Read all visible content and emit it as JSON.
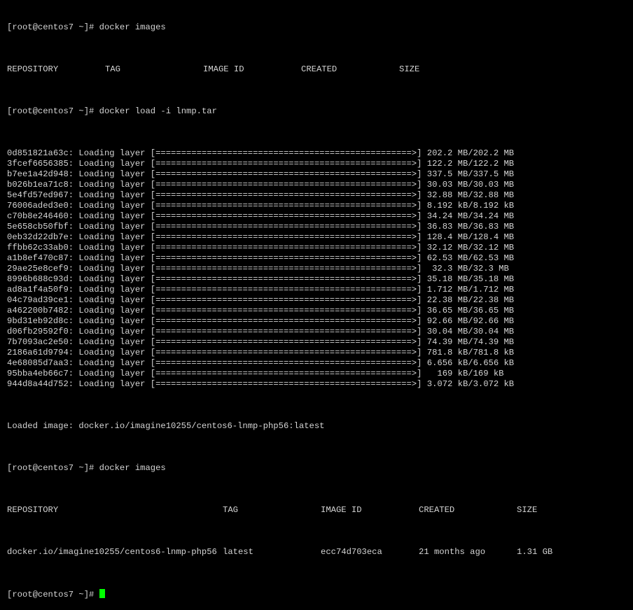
{
  "colors": {
    "background": "#000000",
    "text": "#d4d4d4",
    "cursor": "#00ff00"
  },
  "prompt": "[root@centos7 ~]#",
  "commands": {
    "images1": "docker images",
    "load": "docker load -i lnmp.tar",
    "images2": "docker images"
  },
  "images_header": [
    "REPOSITORY",
    "TAG",
    "IMAGE ID",
    "CREATED",
    "SIZE"
  ],
  "progress_bar": "[==================================================>]",
  "layers": [
    {
      "id": "0d851821a63c",
      "size": "202.2 MB/202.2 MB"
    },
    {
      "id": "3fcef6656385",
      "size": "122.2 MB/122.2 MB"
    },
    {
      "id": "b7ee1a42d948",
      "size": "337.5 MB/337.5 MB"
    },
    {
      "id": "b026b1ea71c8",
      "size": "30.03 MB/30.03 MB"
    },
    {
      "id": "5e4fd57ed967",
      "size": "32.88 MB/32.88 MB"
    },
    {
      "id": "76006aded3e0",
      "size": "8.192 kB/8.192 kB"
    },
    {
      "id": "c70b8e246460",
      "size": "34.24 MB/34.24 MB"
    },
    {
      "id": "5e658cb50fbf",
      "size": "36.83 MB/36.83 MB"
    },
    {
      "id": "0eb32d22db7e",
      "size": "128.4 MB/128.4 MB"
    },
    {
      "id": "ffbb62c33ab0",
      "size": "32.12 MB/32.12 MB"
    },
    {
      "id": "a1b8ef470c87",
      "size": "62.53 MB/62.53 MB"
    },
    {
      "id": "29ae25e8cef9",
      "size": " 32.3 MB/32.3 MB"
    },
    {
      "id": "8996b688c93d",
      "size": "35.18 MB/35.18 MB"
    },
    {
      "id": "ad8a1f4a50f9",
      "size": "1.712 MB/1.712 MB"
    },
    {
      "id": "04c79ad39ce1",
      "size": "22.38 MB/22.38 MB"
    },
    {
      "id": "a462200b7482",
      "size": "36.65 MB/36.65 MB"
    },
    {
      "id": "9bd31eb92d8c",
      "size": "92.66 MB/92.66 MB"
    },
    {
      "id": "d06fb29592f0",
      "size": "30.04 MB/30.04 MB"
    },
    {
      "id": "7b7093ac2e50",
      "size": "74.39 MB/74.39 MB"
    },
    {
      "id": "2186a61d9794",
      "size": "781.8 kB/781.8 kB"
    },
    {
      "id": "4e68085d7aa3",
      "size": "6.656 kB/6.656 kB"
    },
    {
      "id": "95bba4eb66c7",
      "size": "  169 kB/169 kB"
    },
    {
      "id": "944d8a44d752",
      "size": "3.072 kB/3.072 kB"
    }
  ],
  "loaded_message": "Loaded image: docker.io/imagine10255/centos6-lnmp-php56:latest",
  "image_row": {
    "repository": "docker.io/imagine10255/centos6-lnmp-php56",
    "tag": "latest",
    "image_id": "ecc74d703eca",
    "created": "21 months ago",
    "size": "1.31 GB"
  }
}
